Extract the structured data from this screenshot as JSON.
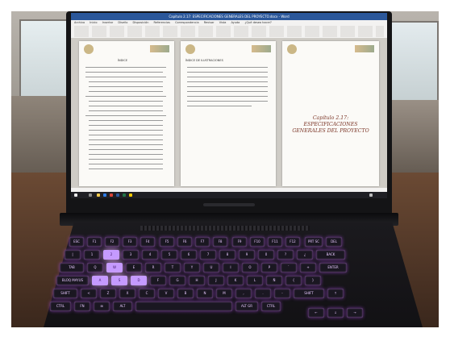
{
  "window": {
    "title": "Capitulo 2.17: ESPECIFICACIONES GENERALES DEL PROYECTO.docx - Word",
    "tabs": [
      "Archivo",
      "Inicio",
      "Insertar",
      "Diseño",
      "Disposición",
      "Referencias",
      "Correspondencia",
      "Revisar",
      "Vista",
      "Ayuda",
      "¿Qué desea hacer?"
    ]
  },
  "document": {
    "page1_heading": "ÍNDICE",
    "page2_heading": "ÍNDICE DE ILUSTRACIONES",
    "chapter_title": "Capítulo 2.17: ESPECIFICACIONES GENERALES DEL PROYECTO"
  },
  "keyboard": {
    "keys_row1": [
      "ESC",
      "F1",
      "F2",
      "F3",
      "F4",
      "F5",
      "F6",
      "F7",
      "F8",
      "F9",
      "F10",
      "F11",
      "F12",
      "PRT SC",
      "DEL"
    ],
    "keys_row2": [
      "|",
      "1",
      "2",
      "3",
      "4",
      "5",
      "6",
      "7",
      "8",
      "9",
      "0",
      "?",
      "¿",
      "BACK"
    ],
    "keys_row3": [
      "TAB",
      "Q",
      "W",
      "E",
      "R",
      "T",
      "Y",
      "U",
      "I",
      "O",
      "P",
      "`",
      "+",
      "ENTER"
    ],
    "keys_row4": [
      "BLOQ MAYUS",
      "A",
      "S",
      "D",
      "F",
      "G",
      "H",
      "J",
      "K",
      "L",
      "Ñ",
      "{",
      "}"
    ],
    "keys_row5": [
      "SHIFT",
      "<",
      "Z",
      "X",
      "C",
      "V",
      "B",
      "N",
      "M",
      ",",
      ".",
      "-",
      "SHIFT",
      "↑"
    ],
    "keys_row6": [
      "CTRL",
      "FN",
      "⊞",
      "ALT",
      "",
      "ALT GR",
      "CTRL",
      "←",
      "↓",
      "→"
    ]
  }
}
